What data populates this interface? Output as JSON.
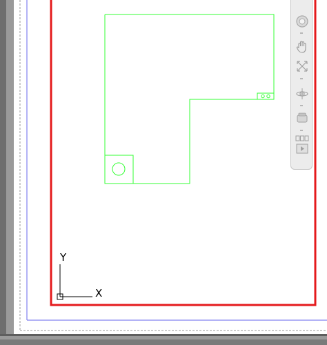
{
  "viewport": {
    "ucs_icon": {
      "x_label": "X",
      "y_label": "Y"
    }
  },
  "navigation_bar": {
    "tools": [
      {
        "name": "steering-wheel-icon"
      },
      {
        "name": "pan-hand-icon"
      },
      {
        "name": "zoom-extents-icon"
      },
      {
        "name": "orbit-icon"
      },
      {
        "name": "showmotion-icon"
      },
      {
        "name": "viewcube-icon"
      },
      {
        "name": "play-icon"
      }
    ]
  },
  "colors": {
    "paper_border": "#e41a1c",
    "geometry": "#33ff33",
    "margin_line": "#4444ff"
  }
}
